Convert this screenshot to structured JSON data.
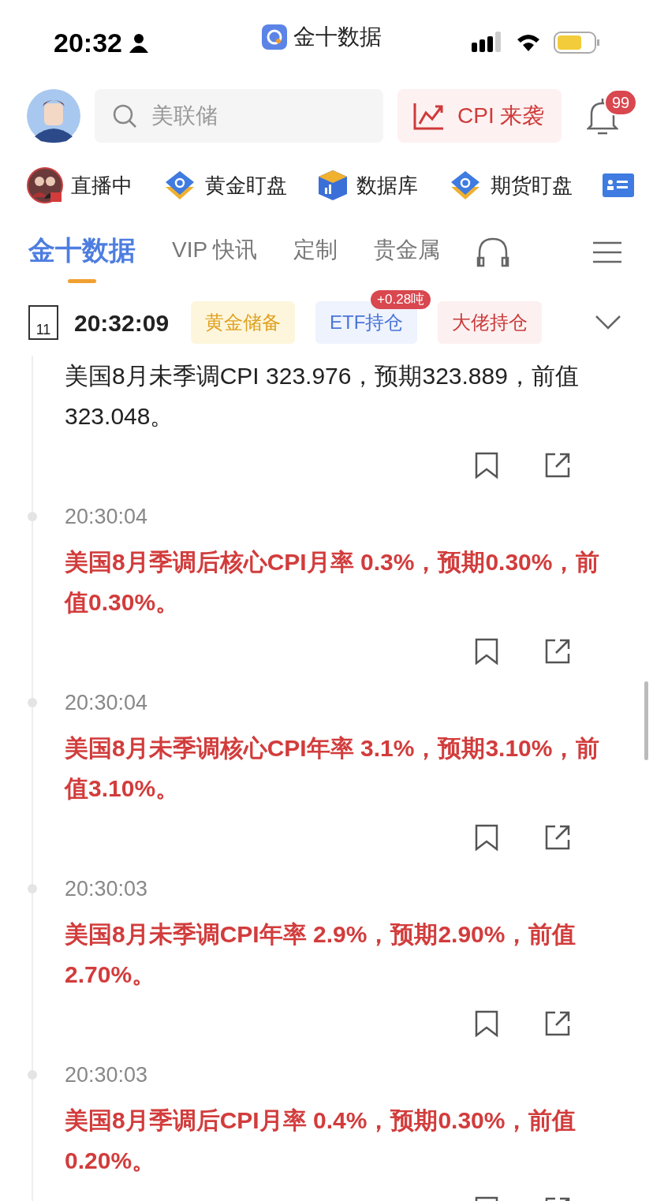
{
  "status_bar": {
    "time": "20:32",
    "app": "金十数据"
  },
  "header": {
    "search": {
      "placeholder": "美联储"
    },
    "promo": "CPI 来袭",
    "badge": "99"
  },
  "shortcuts": [
    {
      "label": "直播中",
      "kind": "live"
    },
    {
      "label": "黄金盯盘",
      "kind": "gold"
    },
    {
      "label": "数据库",
      "kind": "database"
    },
    {
      "label": "期货盯盘",
      "kind": "futures"
    },
    {
      "kind": "card"
    }
  ],
  "tabs": [
    {
      "label": "金十数据",
      "selected": true
    },
    {
      "label": "VIP 快讯",
      "selected": false
    },
    {
      "label": "定制",
      "selected": false
    },
    {
      "label": "贵金属",
      "selected": false
    }
  ],
  "date_bar": {
    "day": "11",
    "time": "20:32:09",
    "chips": [
      {
        "label": "黄金储备",
        "kind": "gold"
      },
      {
        "label": "ETF持仓",
        "kind": "etf",
        "badge": "+0.28吨"
      },
      {
        "label": "大佬持仓",
        "kind": "red"
      }
    ]
  },
  "news": [
    {
      "text": "美国8月未季调CPI 323.976，预期323.889，前值323.048。",
      "important": false
    },
    {
      "time": "20:30:04",
      "text": "美国8月季调后核心CPI月率 0.3%，预期0.30%，前值0.30%。",
      "important": true
    },
    {
      "time": "20:30:04",
      "text": "美国8月未季调核心CPI年率 3.1%，预期3.10%，前值3.10%。",
      "important": true
    },
    {
      "time": "20:30:03",
      "text": "美国8月未季调CPI年率 2.9%，预期2.90%，前值2.70%。",
      "important": true
    },
    {
      "time": "20:30:03",
      "text": "美国8月季调后CPI月率 0.4%，预期0.30%，前值0.20%。",
      "important": true
    }
  ]
}
